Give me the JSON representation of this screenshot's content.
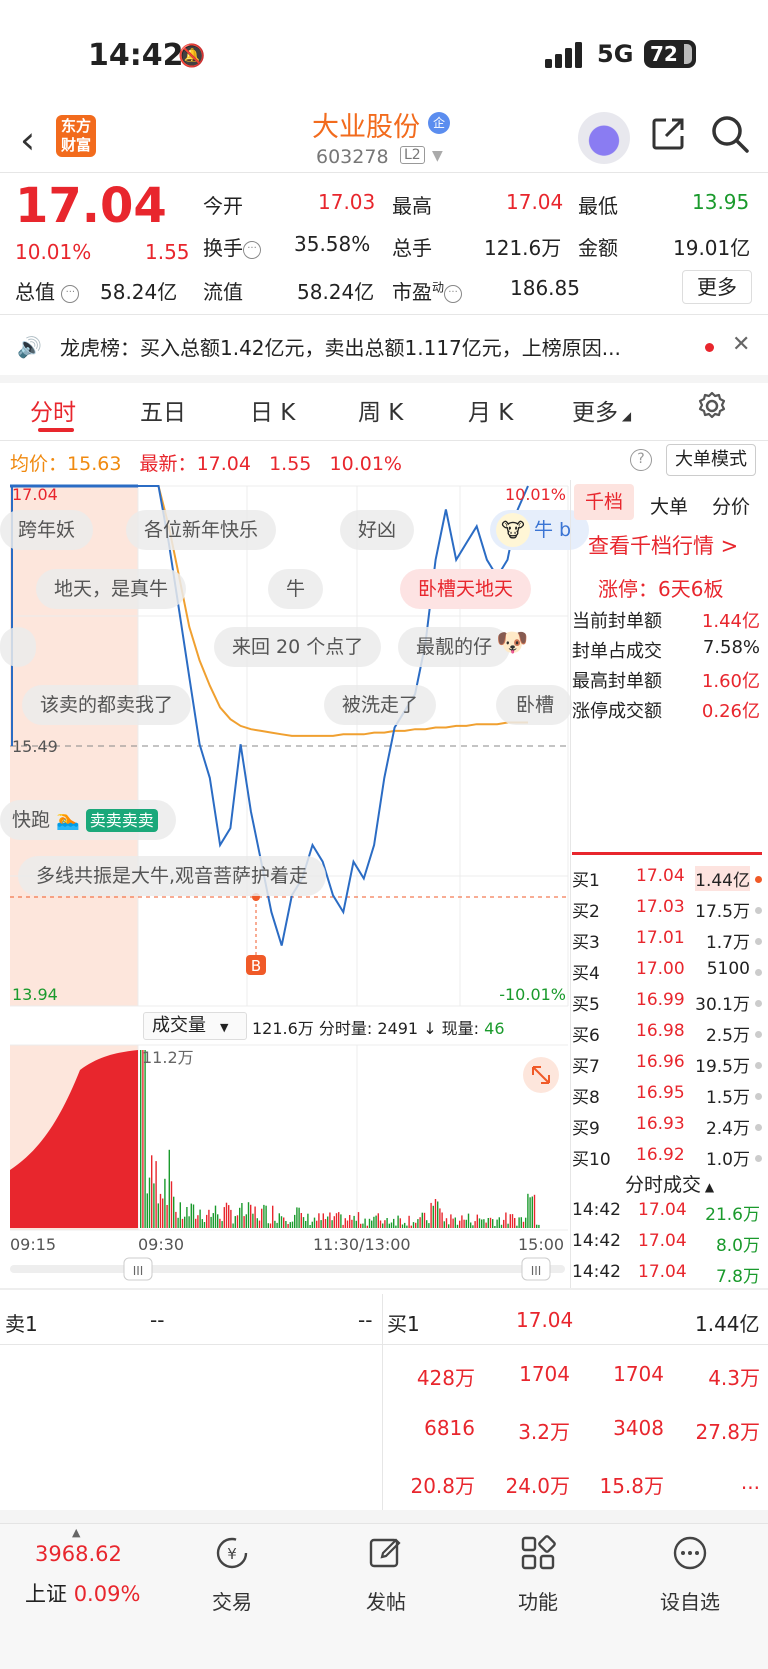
{
  "status_bar": {
    "time": "14:42",
    "network": "5G",
    "battery": "72"
  },
  "header": {
    "logo_text": "东方财富",
    "stock_name": "大业股份",
    "badge": "企",
    "code": "603278",
    "level": "L2"
  },
  "quote": {
    "price": "17.04",
    "change_pct": "10.01%",
    "change": "1.55",
    "market_value_label": "总值",
    "market_value": "58.24亿",
    "items": [
      {
        "label": "今开",
        "value": "17.03",
        "color": "#e8262d"
      },
      {
        "label": "最高",
        "value": "17.04",
        "color": "#e8262d"
      },
      {
        "label": "最低",
        "value": "13.95",
        "color": "#1a9a2c"
      },
      {
        "label": "换手",
        "value": "35.58%",
        "color": "#222"
      },
      {
        "label": "总手",
        "value": "121.6万",
        "color": "#222"
      },
      {
        "label": "金额",
        "value": "19.01亿",
        "color": "#222"
      },
      {
        "label": "流值",
        "value": "58.24亿",
        "color": "#222"
      },
      {
        "label": "市盈",
        "value": "186.85",
        "color": "#222",
        "sup": "动"
      }
    ],
    "more_label": "更多"
  },
  "notice": {
    "text": "龙虎榜：买入总额1.42亿元，卖出总额1.117亿元，上榜原因..."
  },
  "tabs": [
    "分时",
    "五日",
    "日 K",
    "周 K",
    "月 K",
    "更多"
  ],
  "avg_line": {
    "avg_label": "均价：",
    "avg": "15.63",
    "latest_label": "最新：",
    "latest": "17.04",
    "change": "1.55",
    "pct": "10.01%"
  },
  "big_order_mode": "大单模式",
  "chart_data": {
    "type": "line",
    "title": "分时",
    "y_top_label": "17.04",
    "y_bottom_label": "13.94",
    "y_mid_label": "15.49",
    "pct_top_label": "10.01%",
    "pct_bottom_label": "-10.01%",
    "ylim": [
      13.94,
      17.04
    ],
    "x_labels": [
      "09:15",
      "09:30",
      "11:30/13:00",
      "15:00"
    ],
    "series": [
      {
        "name": "price",
        "color": "#2b6cc4",
        "values": [
          17.04,
          17.04,
          17.04,
          16.7,
          16.3,
          15.9,
          15.5,
          15.3,
          14.9,
          15.0,
          15.5,
          15.1,
          14.8,
          14.5,
          14.3,
          14.6,
          14.7,
          14.9,
          14.8,
          14.6,
          14.5,
          14.8,
          14.7,
          14.9,
          15.3,
          15.6,
          15.7,
          15.8,
          16.1,
          16.6,
          16.9,
          16.6,
          16.7,
          16.8,
          16.6,
          16.5,
          16.6,
          16.9,
          17.04
        ]
      },
      {
        "name": "avg",
        "color": "#f0a030",
        "values": [
          17.04,
          17.04,
          17.04,
          16.8,
          16.5,
          16.2,
          16.0,
          15.85,
          15.72,
          15.65,
          15.61,
          15.59,
          15.58,
          15.57,
          15.56,
          15.55,
          15.55,
          15.55,
          15.55,
          15.55,
          15.56,
          15.56,
          15.56,
          15.57,
          15.57,
          15.58,
          15.58,
          15.59,
          15.59,
          15.6,
          15.6,
          15.61,
          15.61,
          15.62,
          15.62,
          15.62,
          15.63,
          15.63,
          15.63
        ]
      }
    ],
    "volume_label": "成交量",
    "volume_total": "121.6万",
    "volume_meta": "分时量: 2491 ↓ 现量:",
    "volume_now": "46",
    "volume_max_label": "11.2万"
  },
  "bubbles": [
    "跨年妖",
    "各位新年快乐",
    "好凶",
    "地天，是真牛",
    "牛",
    "卧槽天地天",
    "来回 20 个点了",
    "最靓的仔",
    "该卖的都卖我了",
    "被洗走了",
    "卧槽",
    "快跑",
    "卖卖卖卖",
    "多线共振是大牛,观音菩萨护着走",
    "牛 b"
  ],
  "marker": "B",
  "right_panel": {
    "tabs": [
      "千档",
      "大单",
      "分价"
    ],
    "link": "查看千档行情 >",
    "limit_up": "涨停：6天6板",
    "rows": [
      {
        "label": "当前封单额",
        "value": "1.44亿"
      },
      {
        "label": "封单占成交",
        "value": "7.58%"
      },
      {
        "label": "最高封单额",
        "value": "1.60亿"
      },
      {
        "label": "涨停成交额",
        "value": "0.26亿"
      }
    ],
    "order_book": [
      {
        "level": "买1",
        "price": "17.04",
        "vol": "1.44亿"
      },
      {
        "level": "买2",
        "price": "17.03",
        "vol": "17.5万"
      },
      {
        "level": "买3",
        "price": "17.01",
        "vol": "1.7万"
      },
      {
        "level": "买4",
        "price": "17.00",
        "vol": "5100"
      },
      {
        "level": "买5",
        "price": "16.99",
        "vol": "30.1万"
      },
      {
        "level": "买6",
        "price": "16.98",
        "vol": "2.5万"
      },
      {
        "level": "买7",
        "price": "16.96",
        "vol": "19.5万"
      },
      {
        "level": "买8",
        "price": "16.95",
        "vol": "1.5万"
      },
      {
        "level": "买9",
        "price": "16.93",
        "vol": "2.4万"
      },
      {
        "level": "买10",
        "price": "16.92",
        "vol": "1.0万"
      }
    ],
    "trades_title": "分时成交",
    "trades": [
      {
        "time": "14:42",
        "price": "17.04",
        "vol": "21.6万"
      },
      {
        "time": "14:42",
        "price": "17.04",
        "vol": "8.0万"
      },
      {
        "time": "14:42",
        "price": "17.04",
        "vol": "7.8万"
      }
    ]
  },
  "bottom_table": {
    "sell_label": "卖1",
    "sell_price": "--",
    "sell_vol": "--",
    "buy_label": "买1",
    "buy_price": "17.04",
    "buy_vol": "1.44亿",
    "cells": [
      [
        "428万",
        "1704",
        "1704",
        "4.3万"
      ],
      [
        "6816",
        "3.2万",
        "3408",
        "27.8万"
      ],
      [
        "20.8万",
        "24.0万",
        "15.8万",
        "..."
      ]
    ]
  },
  "nav": {
    "index_value": "3968.62",
    "index_name": "上证",
    "index_pct": "0.09%",
    "items": [
      "交易",
      "发帖",
      "功能",
      "设自选"
    ]
  }
}
